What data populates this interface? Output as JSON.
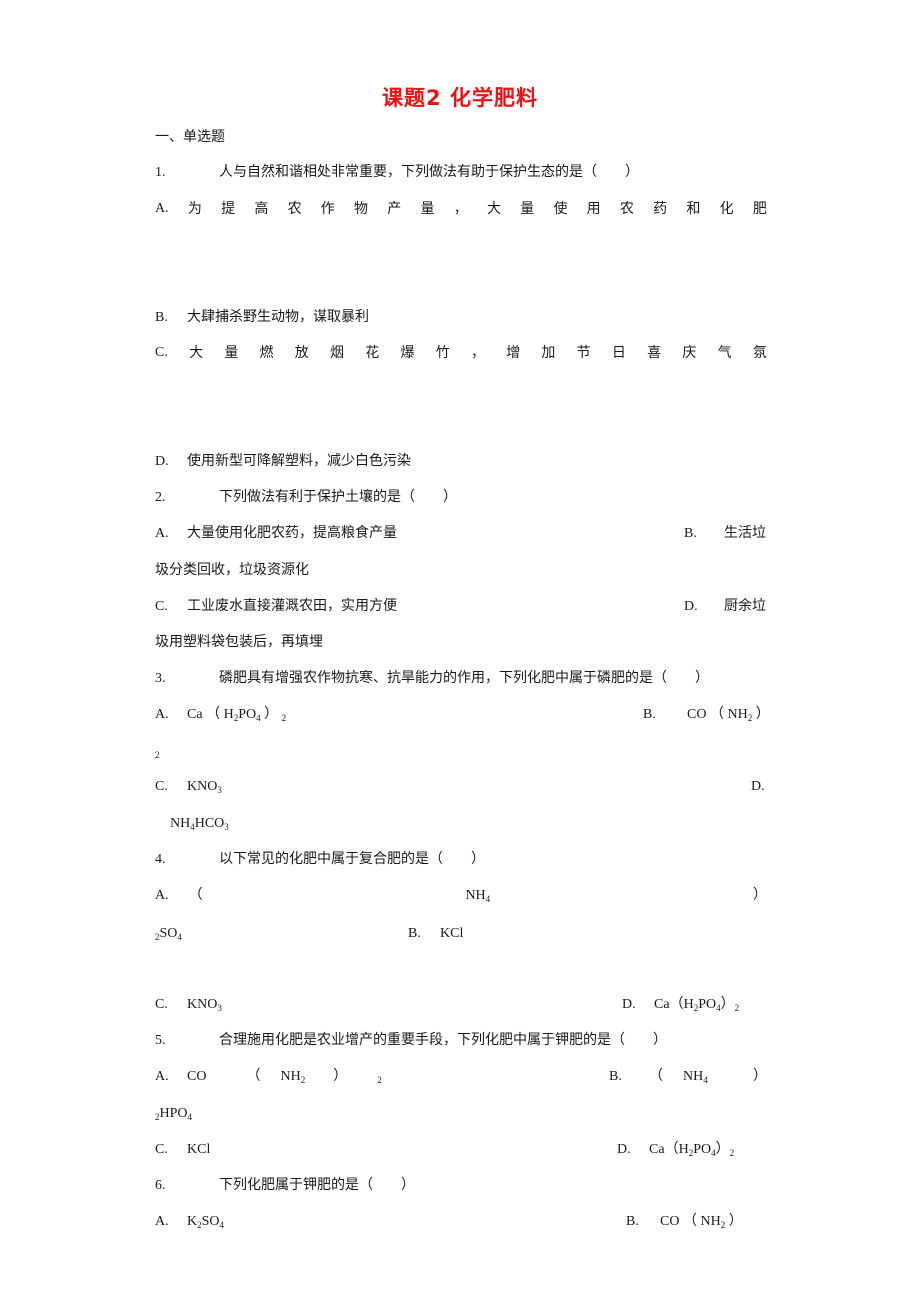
{
  "title": "课题2 化学肥料",
  "section": "一、单选题",
  "questions": [
    {
      "num": "1.",
      "stem": "人与自然和谐相处非常重要，下列做法有助于保护生态的是（　　）",
      "options": {
        "A": {
          "label": "A.",
          "chars": [
            "为",
            "提",
            "高",
            "农",
            "作",
            "物",
            "产",
            "量",
            "，",
            "大",
            "量",
            "使",
            "用",
            "农",
            "药",
            "和",
            "化",
            "肥"
          ]
        },
        "B": {
          "label": "B.",
          "text": "大肆捕杀野生动物，谋取暴利"
        },
        "C": {
          "label": "C.",
          "chars": [
            "大",
            "量",
            "燃",
            "放",
            "烟",
            "花",
            "爆",
            "竹",
            "，",
            "增",
            "加",
            "节",
            "日",
            "喜",
            "庆",
            "气",
            "氛"
          ]
        },
        "D": {
          "label": "D.",
          "text": "使用新型可降解塑料，减少白色污染"
        }
      }
    },
    {
      "num": "2.",
      "stem": "下列做法有利于保护土壤的是（　　）",
      "options": {
        "A": {
          "label": "A.",
          "text": "大量使用化肥农药，提高粮食产量"
        },
        "B": {
          "label": "B.",
          "text": "生活垃",
          "cont": "圾分类回收，垃圾资源化"
        },
        "C": {
          "label": "C.",
          "text": "工业废水直接灌溉农田，实用方便"
        },
        "D": {
          "label": "D.",
          "text": "厨余垃",
          "cont": "圾用塑料袋包装后，再填埋"
        }
      }
    },
    {
      "num": "3.",
      "stem": "磷肥具有增强农作物抗寒、抗旱能力的作用，下列化肥中属于磷肥的是（　　）",
      "options": {
        "A": {
          "label": "A.",
          "text": "Ca（H2PO4）2"
        },
        "B": {
          "label": "B.",
          "text": "CO（NH2）2"
        },
        "C": {
          "label": "C.",
          "text": "KNO3"
        },
        "D": {
          "label": "D.",
          "text": "NH4HCO3"
        }
      }
    },
    {
      "num": "4.",
      "stem": "以下常见的化肥中属于复合肥的是（　　）",
      "options": {
        "A": {
          "label": "A.",
          "text": "（NH4）2SO4"
        },
        "B": {
          "label": "B.",
          "text": "KCl"
        },
        "C": {
          "label": "C.",
          "text": "KNO3"
        },
        "D": {
          "label": "D.",
          "text": "Ca（H2PO4）2"
        }
      }
    },
    {
      "num": "5.",
      "stem": "合理施用化肥是农业增产的重要手段，下列化肥中属于钾肥的是（　　）",
      "options": {
        "A": {
          "label": "A.",
          "text": "CO（NH2）2"
        },
        "B": {
          "label": "B.",
          "text": "（NH4）2HPO4"
        },
        "C": {
          "label": "C.",
          "text": "KCl"
        },
        "D": {
          "label": "D.",
          "text": "Ca（H2PO4）2"
        }
      }
    },
    {
      "num": "6.",
      "stem": "下列化肥属于钾肥的是（　　）",
      "options": {
        "A": {
          "label": "A.",
          "text": "K2SO4"
        },
        "B": {
          "label": "B.",
          "text": "CO（NH2）2"
        }
      }
    }
  ],
  "frag": {
    "paren_open": "（",
    "paren_close": "）",
    "sub2": "2",
    "sub3": "3",
    "sub4": "4",
    "Ca": "Ca",
    "H": "H",
    "PO": "PO",
    "CO": "CO",
    "NH": "NH",
    "KNO": "KNO",
    "HCO": "HCO",
    "SO": "SO",
    "KCl": "KCl",
    "HPO": "HPO",
    "K": "K"
  }
}
